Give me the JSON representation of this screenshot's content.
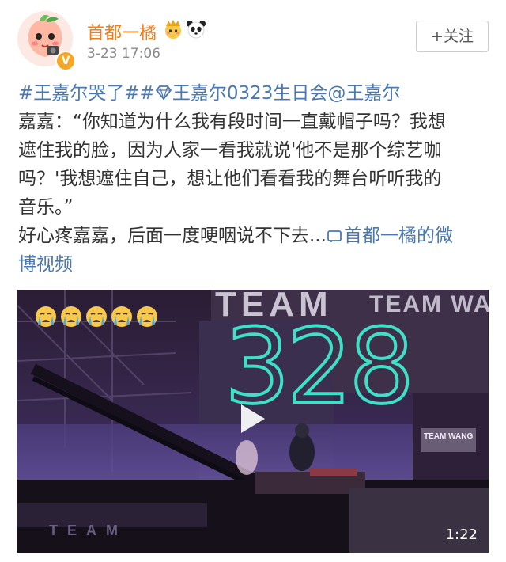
{
  "header": {
    "username": "首都一橘",
    "name_emoji": [
      "crown-face-emoji",
      "panda-emoji"
    ],
    "timestamp": "3-23 17:06",
    "follow_label": "+关注",
    "verified_badge": "V"
  },
  "post": {
    "hashtag1": "#王嘉尔哭了#",
    "hashtag2": "王嘉尔0323生日会",
    "mention": "@王嘉尔",
    "line2": "嘉嘉：“你知道为什么我有段时间一直戴帽子吗？我想",
    "line3": "遮住我的脸，因为人家一看我就说'他不是那个综艺咖",
    "line4": "吗？'我想遮住自己，想让他们看看我的舞台听听我的",
    "line5": "音乐。”",
    "line6_text": "好心疼嘉嘉，后面一度哽咽说不下去...",
    "video_link_part1": "首都一橘的微",
    "video_link_part2": "博视频"
  },
  "video": {
    "emoji_overlay": [
      "crying-emoji",
      "crying-emoji",
      "crying-emoji",
      "crying-emoji",
      "crying-emoji"
    ],
    "screen_text_large": "328",
    "screen_text_top": "TEAM",
    "screen_text_top_right": "TEAM WANG",
    "screen_text_right": "TEAM WANG",
    "screen_text_bottom": "TEAM",
    "duration": "1:22"
  },
  "colors": {
    "link": "#4a78b0",
    "username": "#f07c1a",
    "timestamp": "#8a8a8a",
    "led": "#3fe0c8"
  }
}
